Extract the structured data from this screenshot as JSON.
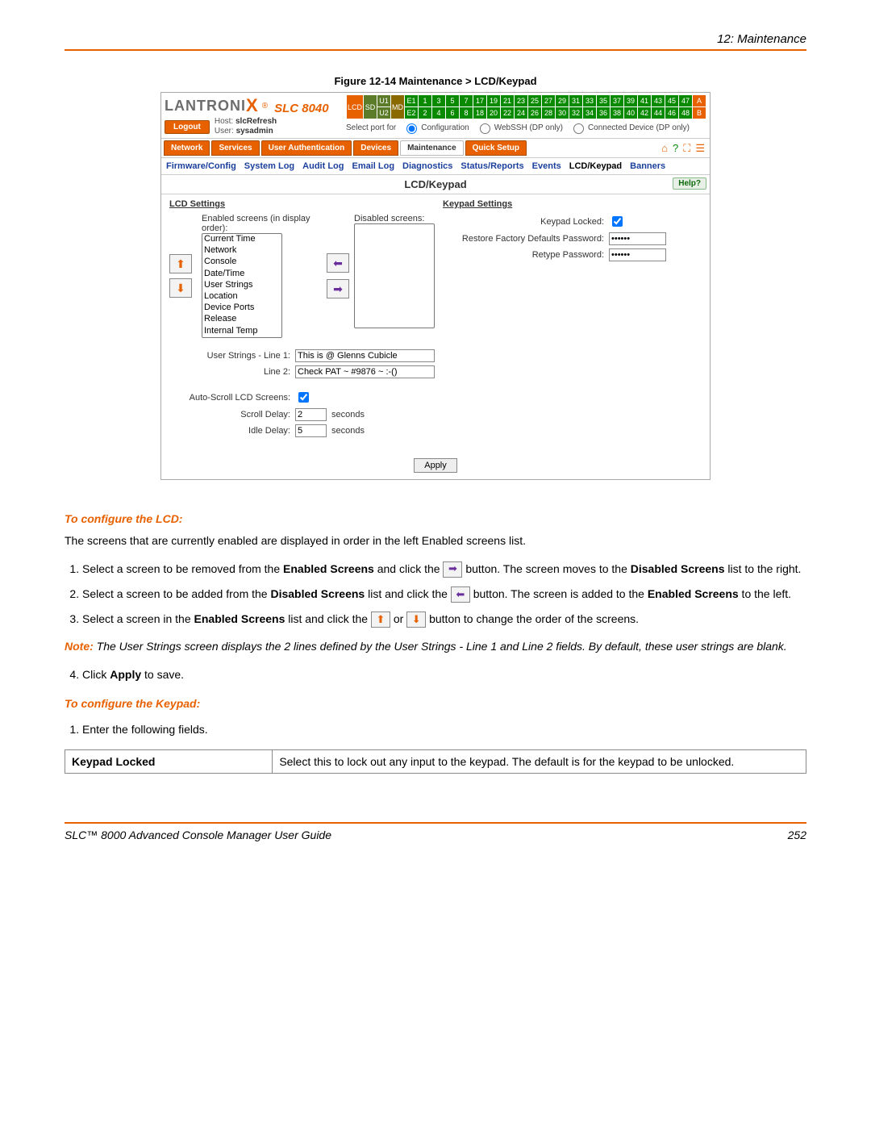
{
  "chapter": "12: Maintenance",
  "figure_title": "Figure 12-14  Maintenance > LCD/Keypad",
  "logo": {
    "brand": "LANTRONI",
    "x": "X",
    "reg": "®",
    "model": "SLC 8040"
  },
  "logout": "Logout",
  "host_label": "Host:",
  "host_value": "slcRefresh",
  "user_label": "User:",
  "user_value": "sysadmin",
  "port_caption_prefix": "Select port for",
  "port_radio1": "Configuration",
  "port_radio2": "WebSSH (DP only)",
  "port_radio3": "Connected Device (DP only)",
  "portgrid_labels": {
    "lcd": "LCD",
    "sd": "SD",
    "md": "MD",
    "u1": "U1",
    "u2": "U2",
    "e1": "E1",
    "e2": "E2",
    "a": "A",
    "b": "B"
  },
  "port_top": [
    "1",
    "3",
    "5",
    "7",
    "17",
    "19",
    "21",
    "23",
    "25",
    "27",
    "29",
    "31",
    "33",
    "35",
    "37",
    "39",
    "41",
    "43",
    "45",
    "47"
  ],
  "port_bottom": [
    "2",
    "4",
    "6",
    "8",
    "18",
    "20",
    "22",
    "24",
    "26",
    "28",
    "30",
    "32",
    "34",
    "36",
    "38",
    "40",
    "42",
    "44",
    "46",
    "48"
  ],
  "tabs": {
    "network": "Network",
    "services": "Services",
    "userauth": "User Authentication",
    "devices": "Devices",
    "maintenance": "Maintenance",
    "quick": "Quick Setup"
  },
  "subnav": {
    "fw": "Firmware/Config",
    "syslog": "System Log",
    "audit": "Audit Log",
    "email": "Email Log",
    "diag": "Diagnostics",
    "status": "Status/Reports",
    "events": "Events",
    "lcd": "LCD/Keypad",
    "banners": "Banners"
  },
  "page_title": "LCD/Keypad",
  "help": "Help?",
  "lcd_section": "LCD Settings",
  "keypad_section": "Keypad Settings",
  "enabled_label": "Enabled screens (in display order):",
  "disabled_label": "Disabled screens:",
  "enabled_items": [
    "Current Time",
    "Network",
    "Console",
    "Date/Time",
    "User Strings",
    "Location",
    "Device Ports",
    "Release",
    "Internal Temp"
  ],
  "line1_label": "User Strings - Line 1:",
  "line1_value": "This is @ Glenns Cubicle",
  "line2_label": "Line 2:",
  "line2_value": "Check PAT ~ #9876 ~ :-()",
  "autoscroll_label": "Auto-Scroll LCD Screens:",
  "scrolldelay_label": "Scroll Delay:",
  "scrolldelay_value": "2",
  "idledelay_label": "Idle Delay:",
  "idledelay_value": "5",
  "seconds": "seconds",
  "keypad_locked_label": "Keypad Locked:",
  "restore_pwd_label": "Restore Factory Defaults Password:",
  "retype_pwd_label": "Retype Password:",
  "apply": "Apply",
  "doc": {
    "h3a": "To configure the LCD:",
    "intro": "The screens that are currently enabled are displayed in order in the left Enabled screens list.",
    "li1a": "Select a screen to be removed from the ",
    "li1b": "Enabled Screens",
    "li1c": " and click the ",
    "li1d": " button. The screen moves to the ",
    "li1e": "Disabled Screens",
    "li1f": " list to the right.",
    "li2a": "Select a screen to be added from the ",
    "li2b": "Disabled Screens",
    "li2c": " list and click the ",
    "li2d": " button. The screen is added to the ",
    "li2e": "Enabled Screens",
    "li2f": " to the left.",
    "li3a": "Select a screen in the ",
    "li3b": "Enabled Screens",
    "li3c": " list and click the ",
    "li3d": " or ",
    "li3e": " button to change the order of the screens.",
    "note_label": "Note:",
    "note_body": "    The User Strings screen displays the 2 lines defined by the User Strings - Line 1 and Line 2 fields. By default, these user strings are blank.",
    "li4a": "Click ",
    "li4b": "Apply",
    "li4c": " to save.",
    "h3b": "To configure the Keypad:",
    "kp_li1": "Enter the following fields.",
    "tbl_k": "Keypad Locked",
    "tbl_v": "Select this to lock out any input to the keypad. The default is for the keypad to be unlocked."
  },
  "footer_left": "SLC™ 8000 Advanced Console Manager User Guide",
  "footer_right": "252"
}
